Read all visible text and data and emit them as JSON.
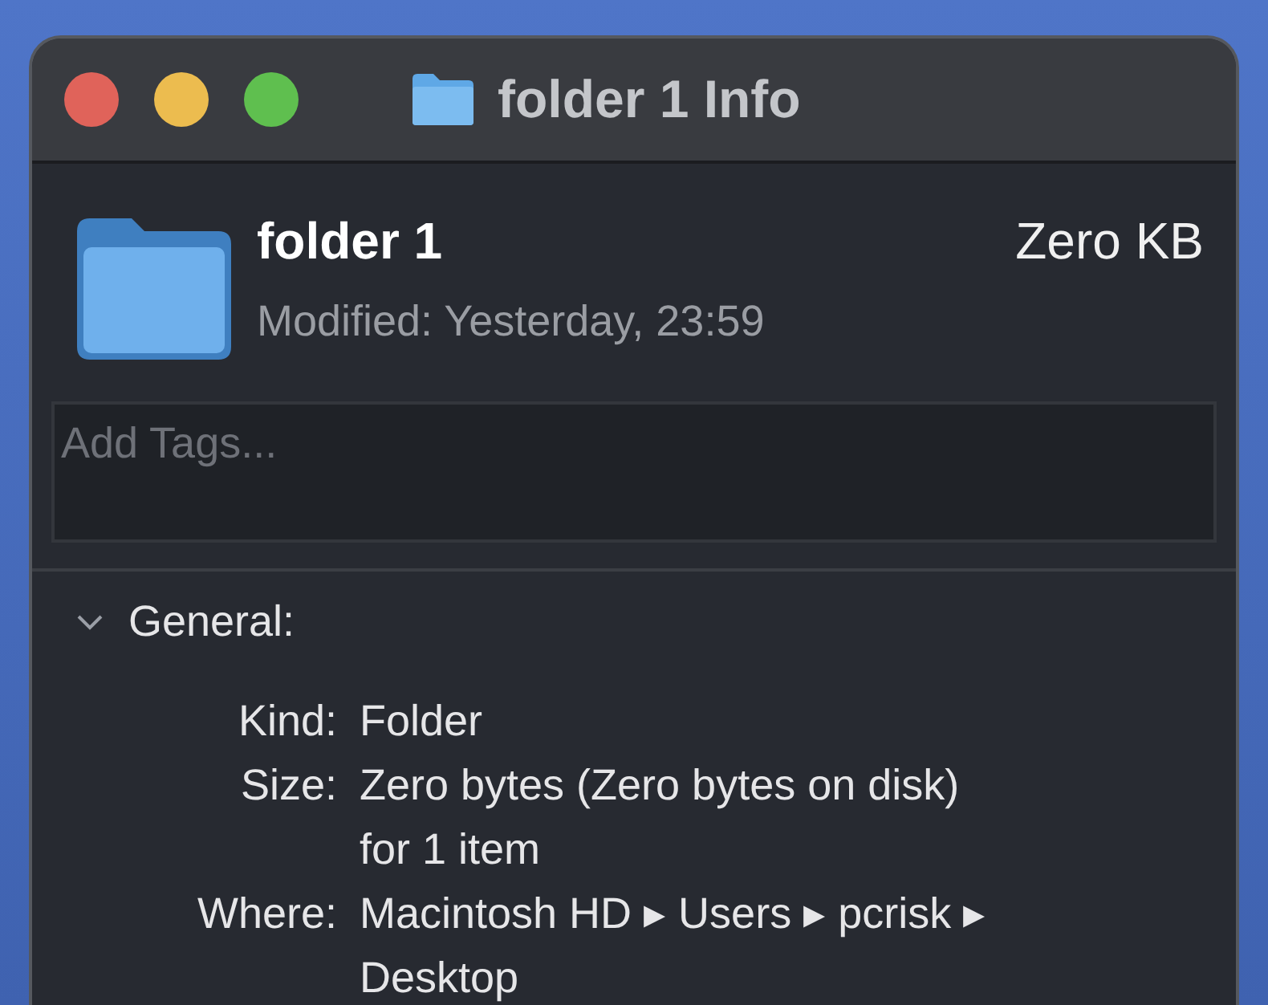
{
  "window": {
    "title": "folder 1 Info"
  },
  "header": {
    "name": "folder 1",
    "modified": "Modified: Yesterday, 23:59",
    "size": "Zero KB"
  },
  "tags": {
    "placeholder": "Add Tags..."
  },
  "section": {
    "title": "General:",
    "expanded": true,
    "rows": [
      {
        "label": "Kind:",
        "value": "Folder"
      },
      {
        "label": "Size:",
        "value": "Zero bytes (Zero bytes on disk) for 1 item"
      },
      {
        "label": "Where:",
        "value": "Macintosh HD ▸ Users ▸ pcrisk ▸ Desktop"
      }
    ]
  }
}
